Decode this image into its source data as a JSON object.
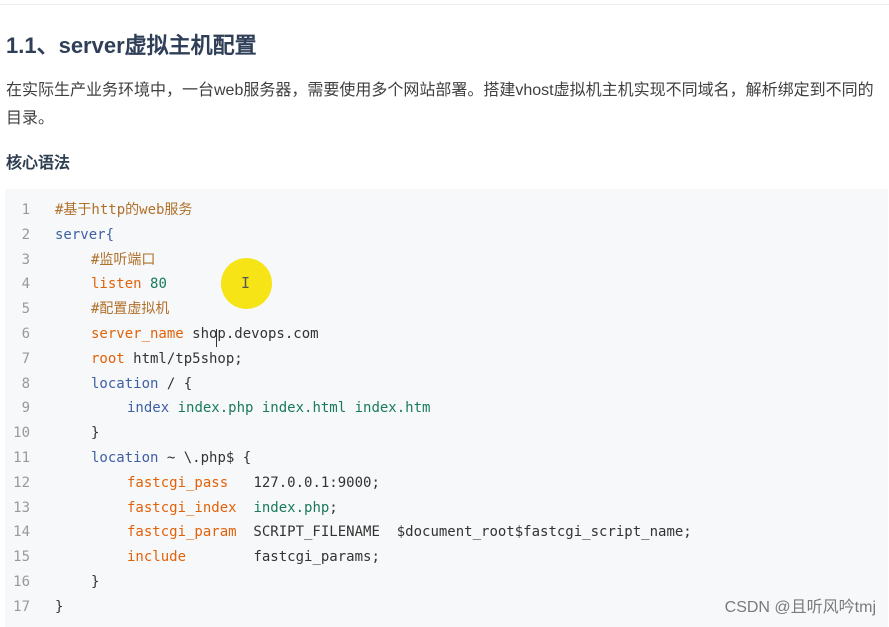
{
  "heading": "1.1、server虚拟主机配置",
  "paragraph": "在实际生产业务环境中，一台web服务器，需要使用多个网站部署。搭建vhost虚拟机主机实现不同域名，解析绑定到不同的目录。",
  "subheading": "核心语法",
  "code_lines": [
    {
      "num": "1",
      "indent": 0,
      "tokens": [
        {
          "cls": "c",
          "text": "#基于http的web服务"
        }
      ]
    },
    {
      "num": "2",
      "indent": 0,
      "tokens": [
        {
          "cls": "k",
          "text": "server{"
        }
      ]
    },
    {
      "num": "3",
      "indent": 1,
      "tokens": [
        {
          "cls": "c",
          "text": "#监听端口"
        }
      ]
    },
    {
      "num": "4",
      "indent": 1,
      "tokens": [
        {
          "cls": "d",
          "text": "listen"
        },
        {
          "cls": "t",
          "text": " "
        },
        {
          "cls": "n",
          "text": "80"
        }
      ]
    },
    {
      "num": "5",
      "indent": 1,
      "tokens": [
        {
          "cls": "c",
          "text": "#配置虚拟机"
        }
      ]
    },
    {
      "num": "6",
      "indent": 1,
      "tokens": [
        {
          "cls": "d",
          "text": "server_name"
        },
        {
          "cls": "t",
          "text": " shop.devops.com"
        }
      ]
    },
    {
      "num": "7",
      "indent": 1,
      "tokens": [
        {
          "cls": "d",
          "text": "root"
        },
        {
          "cls": "t",
          "text": " html/tp5shop;"
        }
      ]
    },
    {
      "num": "8",
      "indent": 1,
      "tokens": [
        {
          "cls": "k",
          "text": "location"
        },
        {
          "cls": "t",
          "text": " / {"
        }
      ]
    },
    {
      "num": "9",
      "indent": 2,
      "tokens": [
        {
          "cls": "k",
          "text": "index"
        },
        {
          "cls": "t",
          "text": " "
        },
        {
          "cls": "n",
          "text": "index.php index.html index.htm"
        }
      ]
    },
    {
      "num": "10",
      "indent": 1,
      "tokens": [
        {
          "cls": "t",
          "text": "}"
        }
      ]
    },
    {
      "num": "11",
      "indent": 1,
      "tokens": [
        {
          "cls": "k",
          "text": "location"
        },
        {
          "cls": "t",
          "text": " ~ \\.php$ {"
        }
      ]
    },
    {
      "num": "12",
      "indent": 2,
      "tokens": [
        {
          "cls": "d",
          "text": "fastcgi_pass"
        },
        {
          "cls": "t",
          "text": "   127.0.0.1:9000;"
        }
      ]
    },
    {
      "num": "13",
      "indent": 2,
      "tokens": [
        {
          "cls": "d",
          "text": "fastcgi_index"
        },
        {
          "cls": "t",
          "text": "  "
        },
        {
          "cls": "n",
          "text": "index.php"
        },
        {
          "cls": "t",
          "text": ";"
        }
      ]
    },
    {
      "num": "14",
      "indent": 2,
      "tokens": [
        {
          "cls": "d",
          "text": "fastcgi_param"
        },
        {
          "cls": "t",
          "text": "  SCRIPT_FILENAME  $document_root$fastcgi_script_name;"
        }
      ]
    },
    {
      "num": "15",
      "indent": 2,
      "tokens": [
        {
          "cls": "d",
          "text": "include"
        },
        {
          "cls": "t",
          "text": "        fastcgi_params;"
        }
      ]
    },
    {
      "num": "16",
      "indent": 1,
      "tokens": [
        {
          "cls": "t",
          "text": "}"
        }
      ]
    },
    {
      "num": "17",
      "indent": 0,
      "tokens": [
        {
          "cls": "t",
          "text": "}"
        }
      ]
    }
  ],
  "ibeam_glyph": "I",
  "watermark": "CSDN @且听风吟tmj"
}
